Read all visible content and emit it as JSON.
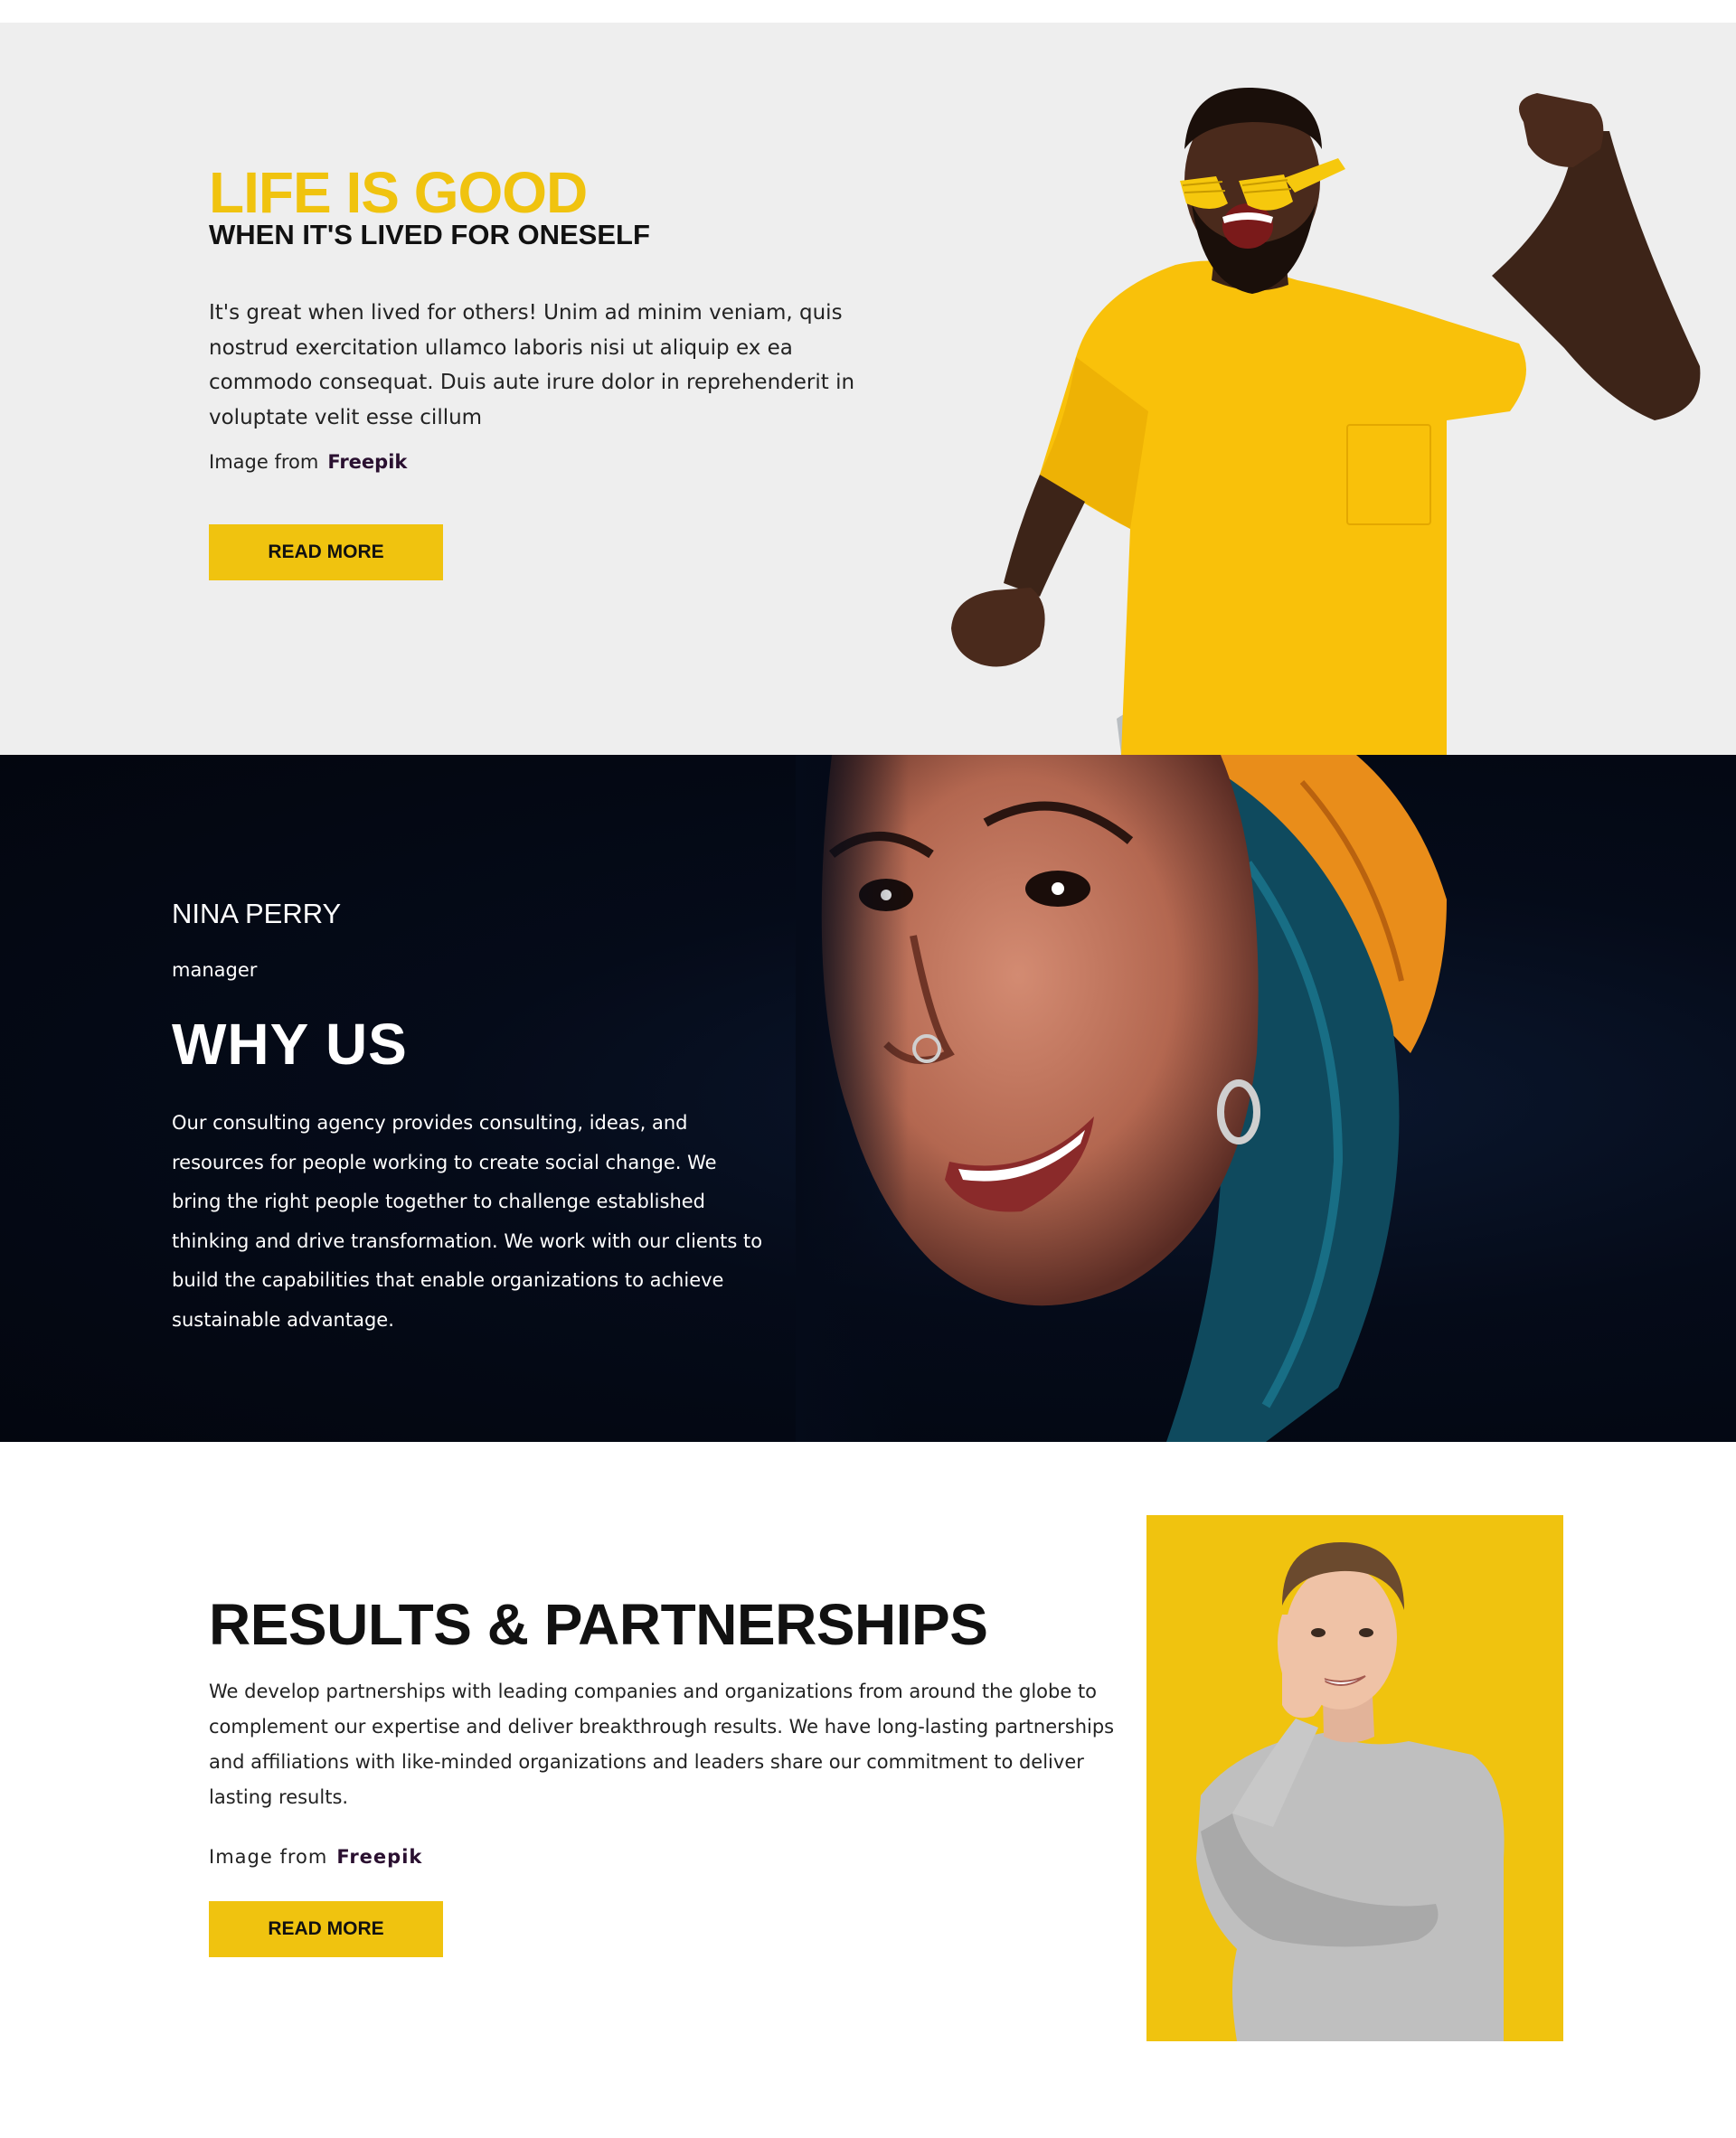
{
  "colors": {
    "accent": "#f0c30f",
    "hero_bg": "#eeeeee",
    "dark_bg": "#050b19",
    "text_dark": "#111111",
    "credit_link": "#2a1030"
  },
  "hero": {
    "title": "LIFE IS GOOD",
    "subtitle": "WHEN IT'S LIVED FOR ONESELF",
    "body": "It's great when lived for others! Unim ad minim veniam, quis nostrud exercitation ullamco laboris nisi ut aliquip ex ea commodo consequat. Duis aute irure dolor in reprehenderit in voluptate velit esse cillum",
    "credit_prefix": "Image from",
    "credit_link": "Freepik",
    "button_label": "READ MORE",
    "image_icon": "man-in-yellow-shirt-photo"
  },
  "why_us": {
    "name": "NINA PERRY",
    "role": "manager",
    "title": "WHY US",
    "body": "Our consulting agency provides consulting, ideas, and resources for people working to create social change. We bring the right people together to challenge established thinking and drive transformation. We work with our clients to build the capabilities that enable organizations to achieve sustainable advantage.",
    "image_icon": "smiling-woman-portrait-photo"
  },
  "results": {
    "title": "RESULTS & PARTNERSHIPS",
    "body": "We develop partnerships with leading companies and organizations from around the globe to complement our expertise and deliver breakthrough results. We have long-lasting partnerships and affiliations with like-minded organizations and leaders share our commitment to deliver lasting results.",
    "credit_prefix": "Image from",
    "credit_link": "Freepik",
    "button_label": "READ MORE",
    "image_icon": "man-in-grey-sweater-photo"
  }
}
